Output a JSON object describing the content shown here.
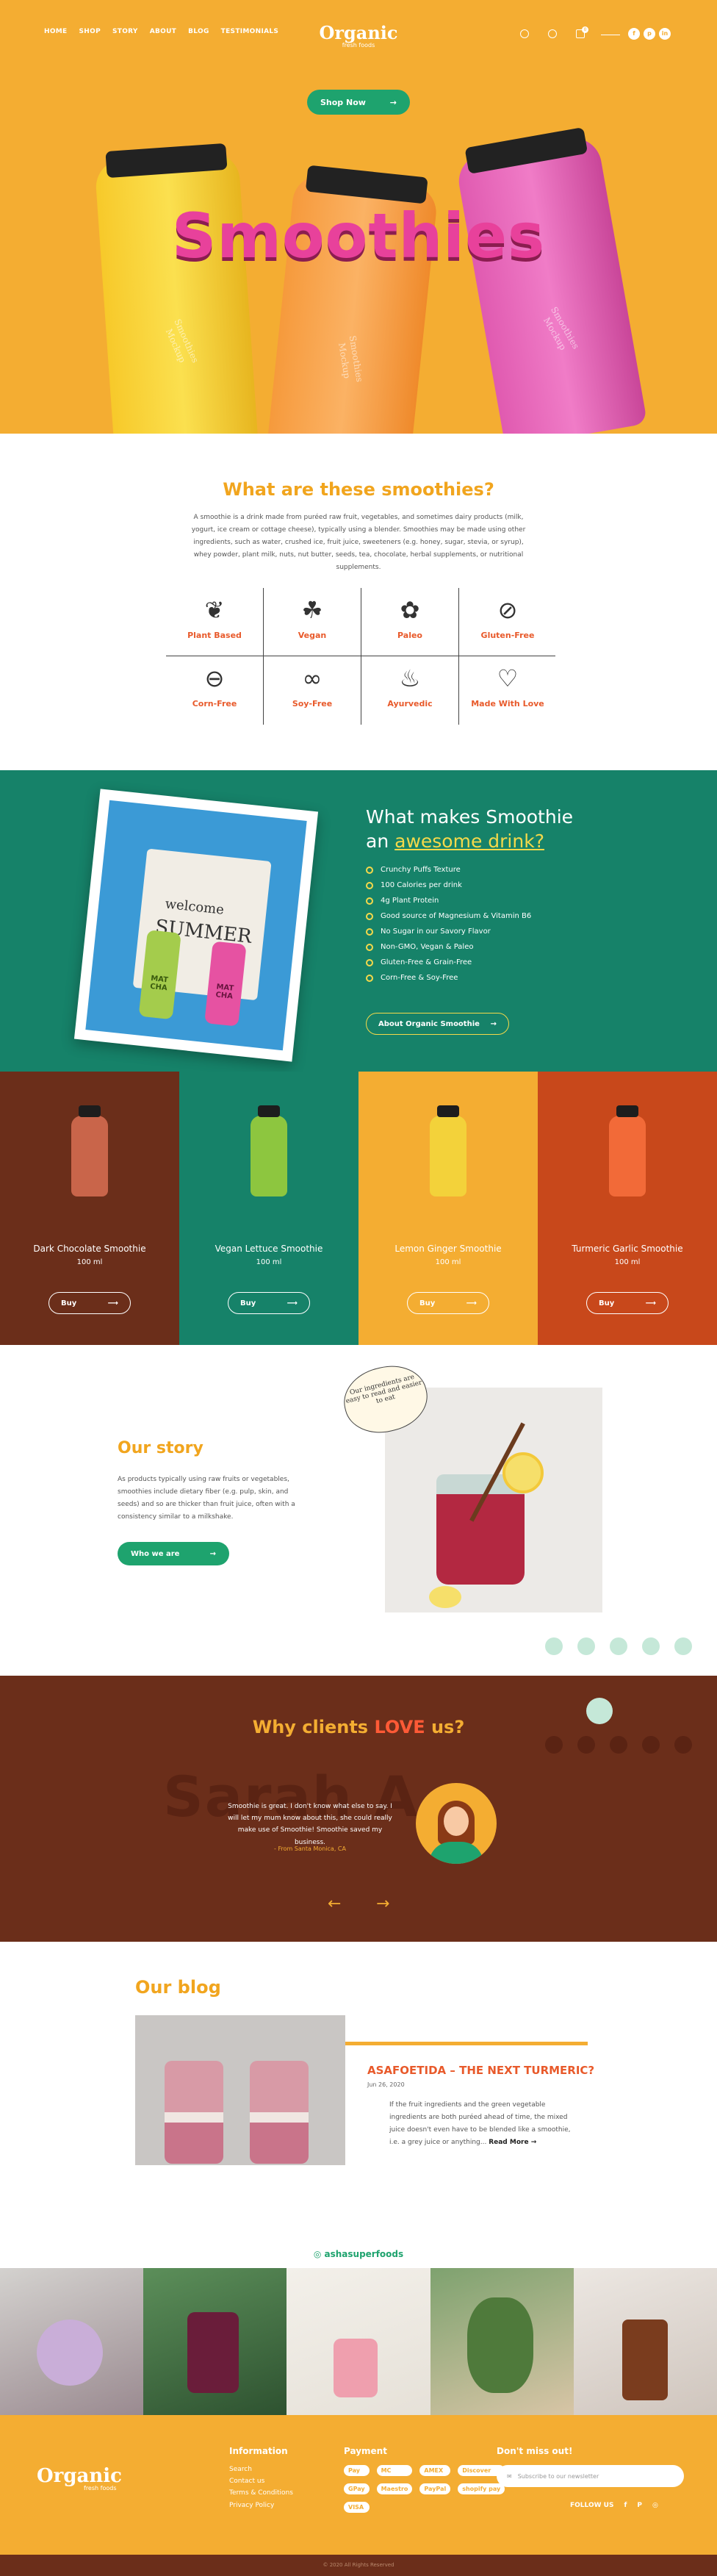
{
  "header": {
    "nav": [
      "HOME",
      "SHOP",
      "STORY",
      "ABOUT",
      "BLOG",
      "TESTIMONIALS"
    ],
    "logo": "Organic",
    "logo_sub": "fresh foods",
    "cart_count": "0",
    "social": [
      "f",
      "p",
      "in"
    ],
    "icons": [
      "search-icon",
      "user-icon",
      "cart-icon"
    ]
  },
  "hero": {
    "shop_button": "Shop Now",
    "title": "Smoothies",
    "bottle_labels": [
      "Smoothies\nMockup",
      "Smoothies\nMockup",
      "Smoothies\nMockup"
    ],
    "colors": {
      "bg": "#f4ad32",
      "title": "#e8419b"
    }
  },
  "what": {
    "title": "What are these smoothies?",
    "description": "A smoothie is a drink made from puréed raw fruit, vegetables, and sometimes dairy products (milk, yogurt, ice cream or cottage cheese), typically using a blender. Smoothies may be made using other ingredients, such as water, crushed ice, fruit juice, sweeteners (e.g. honey, sugar, stevia, or syrup), whey powder, plant milk, nuts, nut butter, seeds, tea, chocolate, herbal supplements, or nutritional supplements.",
    "features": [
      {
        "label": "Plant Based",
        "icon": "plant-icon"
      },
      {
        "label": "Vegan",
        "icon": "vegan-icon"
      },
      {
        "label": "Paleo",
        "icon": "paleo-icon"
      },
      {
        "label": "Gluten-Free",
        "icon": "gluten-free-icon"
      },
      {
        "label": "Corn-Free",
        "icon": "corn-icon"
      },
      {
        "label": "Soy-Free",
        "icon": "soy-icon"
      },
      {
        "label": "Ayurvedic",
        "icon": "ayurvedic-icon"
      },
      {
        "label": "Made With Love",
        "icon": "heart-icon"
      }
    ]
  },
  "makes": {
    "title_1": "What makes Smoothie",
    "title_2a": "an ",
    "title_2b": "awesome drink?",
    "photo_text_1": "welcome",
    "photo_text_2": "SUMMER",
    "photo_bottle_1": "MAT\nCHA",
    "photo_bottle_2": "MAT\nCHA",
    "list": [
      "Crunchy Puffs Texture",
      "100 Calories per drink",
      "4g Plant Protein",
      "Good source of Magnesium & Vitamin B6",
      "No Sugar in our Savory Flavor",
      "Non-GMO, Vegan & Paleo",
      "Gluten-Free & Grain-Free",
      "Corn-Free & Soy-Free"
    ],
    "button": "About Organic Smoothie"
  },
  "products": [
    {
      "name": "Dark Chocolate Smoothie",
      "size": "100 ml",
      "buy": "Buy",
      "bg": "#6b2e1a",
      "bottle": "#c9654a"
    },
    {
      "name": "Vegan Lettuce Smoothie",
      "size": "100 ml",
      "buy": "Buy",
      "bg": "#168269",
      "bottle": "#8dc63f"
    },
    {
      "name": "Lemon Ginger Smoothie",
      "size": "100 ml",
      "buy": "Buy",
      "bg": "#f4ad32",
      "bottle": "#f3d23a"
    },
    {
      "name": "Turmeric Garlic Smoothie",
      "size": "100 ml",
      "buy": "Buy",
      "bg": "#c8481b",
      "bottle": "#f26a38"
    }
  ],
  "story": {
    "title": "Our story",
    "text": "As products typically using raw fruits or vegetables, smoothies include dietary fiber (e.g. pulp, skin, and seeds) and so are thicker than fruit juice, often with a consistency similar to a milkshake.",
    "button": "Who we are",
    "note": "Our ingredients are easy to read and easier to eat"
  },
  "clients": {
    "title_a": "Why clients ",
    "title_b": "LOVE",
    "title_c": " us?",
    "bg_text": "Sarah A",
    "quote": "Smoothie is great. I don't know what else to say. I will let my mum know about this, she could really make use of Smoothie! Smoothie saved my business.",
    "author": "- From Santa Monica, CA",
    "prev": "←",
    "next": "→"
  },
  "blog": {
    "title": "Our blog",
    "post_title": "ASAFOETIDA – THE NEXT TURMERIC?",
    "post_date": "Jun 26, 2020",
    "post_text": "If the fruit ingredients and the green vegetable ingredients are both puréed ahead of time, the mixed juice doesn't even have to be blended like a smoothie, i.e. a grey juice or anything... ",
    "read_more": "Read More →"
  },
  "instagram": {
    "handle": "ashasuperfoods"
  },
  "footer": {
    "logo": "Organic",
    "logo_sub": "fresh foods",
    "info_title": "Information",
    "info_links": [
      "Search",
      "Contact us",
      "Terms & Conditions",
      "Privacy Policy"
    ],
    "pay_title": "Payment",
    "payments": [
      "Pay",
      "MC",
      "AMEX",
      "Discover",
      "GPay",
      "Maestro",
      "PayPal",
      "shopify pay",
      "VISA"
    ],
    "newsletter_title": "Don't miss out!",
    "newsletter_placeholder": "Subscribe to our newsletter",
    "follow": "FOLLOW US",
    "copyright": "© 2020 All Rights Reserved"
  }
}
